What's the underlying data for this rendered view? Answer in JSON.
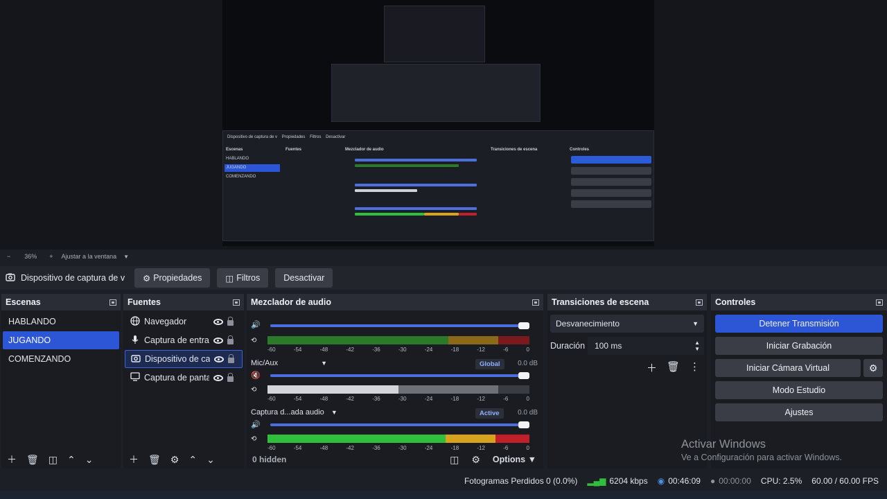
{
  "preview": {
    "zoom_minus": "−",
    "zoom_level": "36%",
    "zoom_plus": "+",
    "zoom_fit": "Ajustar a la ventana"
  },
  "source_toolbar": {
    "source_name": "Dispositivo de captura de v",
    "properties": "Propiedades",
    "filters": "Filtros",
    "deactivate": "Desactivar"
  },
  "scenes": {
    "title": "Escenas",
    "items": [
      "HABLANDO",
      "JUGANDO",
      "COMENZANDO"
    ],
    "active_index": 1
  },
  "sources": {
    "title": "Fuentes",
    "items": [
      {
        "name": "Navegador",
        "icon": "globe-icon"
      },
      {
        "name": "Captura de entrada de audio",
        "icon": "mic-icon"
      },
      {
        "name": "Dispositivo de captura de video",
        "icon": "camera-icon"
      },
      {
        "name": "Captura de pantalla",
        "icon": "monitor-icon"
      }
    ],
    "active_index": 2
  },
  "mixer": {
    "title": "Mezclador de audio",
    "tracks": [
      {
        "name": "",
        "db": "",
        "tag": ""
      },
      {
        "name": "Mic/Aux",
        "db": "0.0 dB",
        "tag": "Global"
      },
      {
        "name": "Captura d...ada audio",
        "db": "0.0 dB",
        "tag": "Active"
      }
    ],
    "scale": [
      "-60",
      "-54",
      "-48",
      "-42",
      "-36",
      "-30",
      "-24",
      "-18",
      "-12",
      "-6",
      "0"
    ],
    "hidden": "0 hidden",
    "options": "Options"
  },
  "transitions": {
    "title": "Transiciones de escena",
    "selected": "Desvanecimiento",
    "duration_label": "Duración",
    "duration_value": "100 ms"
  },
  "controls": {
    "title": "Controles",
    "stop_stream": "Detener Transmisión",
    "start_recording": "Iniciar Grabación",
    "start_virtual_cam": "Iniciar Cámara Virtual",
    "studio_mode": "Modo Estudio",
    "settings": "Ajustes"
  },
  "watermark": {
    "title": "Activar Windows",
    "subtitle": "Ve a Configuración para activar Windows."
  },
  "status": {
    "dropped_frames": "Fotogramas Perdidos 0 (0.0%)",
    "bitrate": "6204 kbps",
    "stream_time": "00:46:09",
    "rec_time": "00:00:00",
    "cpu": "CPU: 2.5%",
    "fps": "60.00 / 60.00 FPS"
  },
  "colors": {
    "accent": "#2d56d6",
    "meter_green": "#2fbf3c",
    "meter_yellow": "#d7a21c",
    "meter_red": "#c0202a"
  }
}
